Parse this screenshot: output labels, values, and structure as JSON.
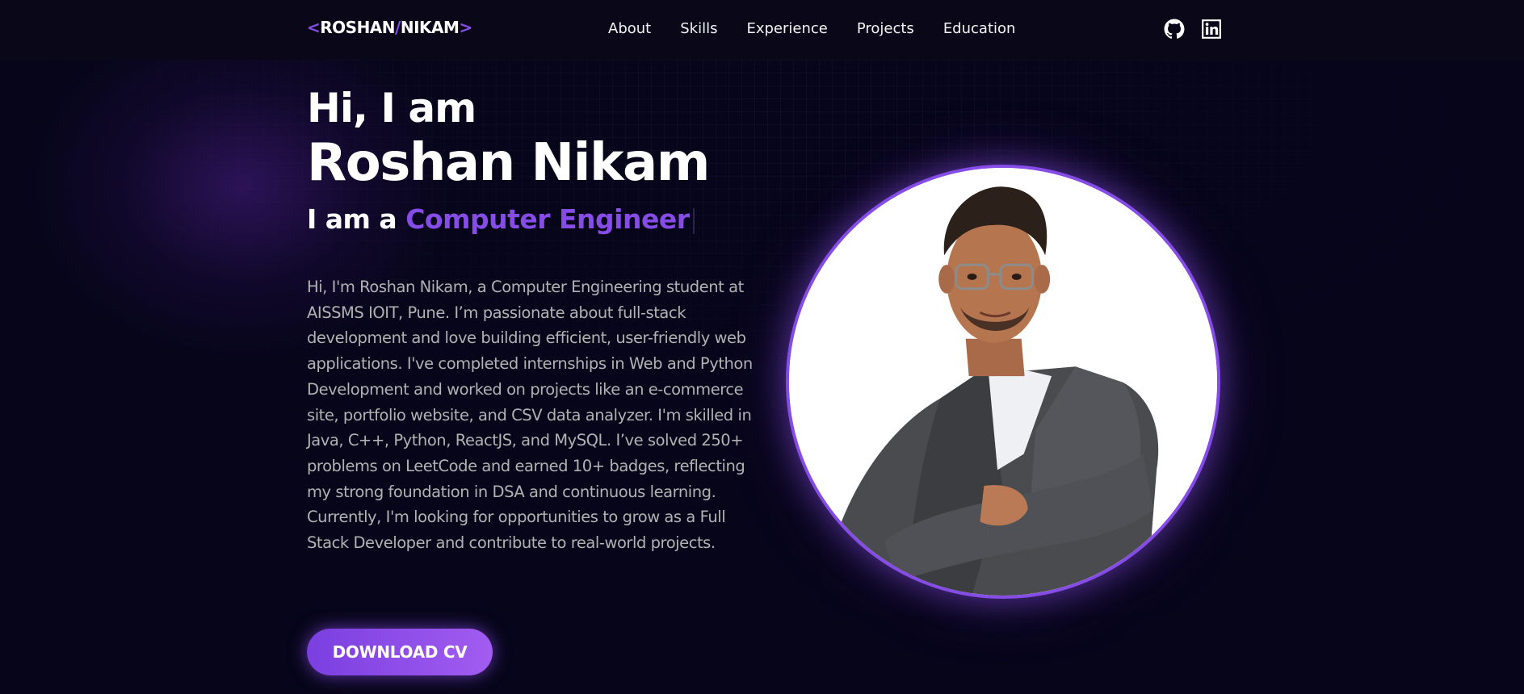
{
  "navbar": {
    "logo": {
      "left_bracket": "<",
      "first": "ROSHAN",
      "slash": "/",
      "last": "NIKAM",
      "right_bracket": ">"
    },
    "links": [
      {
        "label": "About"
      },
      {
        "label": "Skills"
      },
      {
        "label": "Experience"
      },
      {
        "label": "Projects"
      },
      {
        "label": "Education"
      }
    ],
    "socials": [
      {
        "icon": "github-icon"
      },
      {
        "icon": "linkedin-icon"
      }
    ]
  },
  "hero": {
    "greeting": "Hi, I am",
    "name": "Roshan Nikam",
    "role_prefix": "I am a",
    "role_typed": "Computer Engineer",
    "bio": "Hi, I'm Roshan Nikam, a Computer Engineering student at AISSMS IOIT, Pune. I’m passionate about full-stack development and love building efficient, user-friendly web applications. I've completed internships in Web and Python Development and worked on projects like an e-commerce site, portfolio website, and CSV data analyzer. I'm skilled in Java, C++, Python, ReactJS, and MySQL. I’ve solved 250+ problems on LeetCode and earned 10+ badges, reflecting my strong foundation in DSA and continuous learning. Currently, I'm looking for opportunities to grow as a Full Stack Developer and contribute to real-world projects.",
    "cv_button_label": "DOWNLOAD CV"
  },
  "colors": {
    "background": "#07051a",
    "primary": "#854ce6",
    "text_primary": "#ffffff",
    "text_secondary": "#b1b2b3"
  }
}
